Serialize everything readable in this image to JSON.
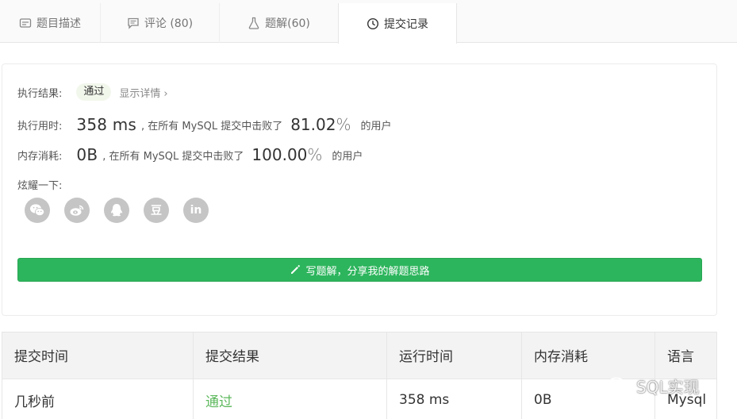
{
  "tabs": [
    {
      "label": "题目描述",
      "icon": "description-icon"
    },
    {
      "label": "评论 (80)",
      "icon": "comment-icon"
    },
    {
      "label": "题解(60)",
      "icon": "flask-icon"
    },
    {
      "label": "提交记录",
      "icon": "clock-icon",
      "active": true
    }
  ],
  "result": {
    "status_label": "执行结果:",
    "status_value": "通过",
    "details_link": "显示详情",
    "runtime_label": "执行用时:",
    "runtime_value": "358 ms",
    "runtime_mid": ", 在所有 MySQL 提交中击败了",
    "runtime_pct": "81.02",
    "runtime_tail": "的用户",
    "memory_label": "内存消耗:",
    "memory_value": "0B",
    "memory_mid": ", 在所有 MySQL 提交中击败了",
    "memory_pct": "100.00",
    "memory_tail": "的用户",
    "percent_sign": "%",
    "share_label": "炫耀一下:",
    "share_icons": [
      "wechat-icon",
      "weibo-icon",
      "qq-icon",
      "douban-icon",
      "linkedin-icon"
    ],
    "share_glyphs": {
      "douban": "豆",
      "linkedin": "in"
    },
    "write_button": "写题解，分享我的解题思路"
  },
  "table": {
    "headers": [
      "提交时间",
      "提交结果",
      "运行时间",
      "内存消耗",
      "语言"
    ],
    "rows": [
      [
        "几秒前",
        "通过",
        "358 ms",
        "0B",
        "Mysql"
      ]
    ]
  },
  "watermark": "SQL实现",
  "colors": {
    "accent_green": "#2db55d",
    "pass_green": "#5cb85c",
    "icon_gray": "#c5c5c5"
  }
}
